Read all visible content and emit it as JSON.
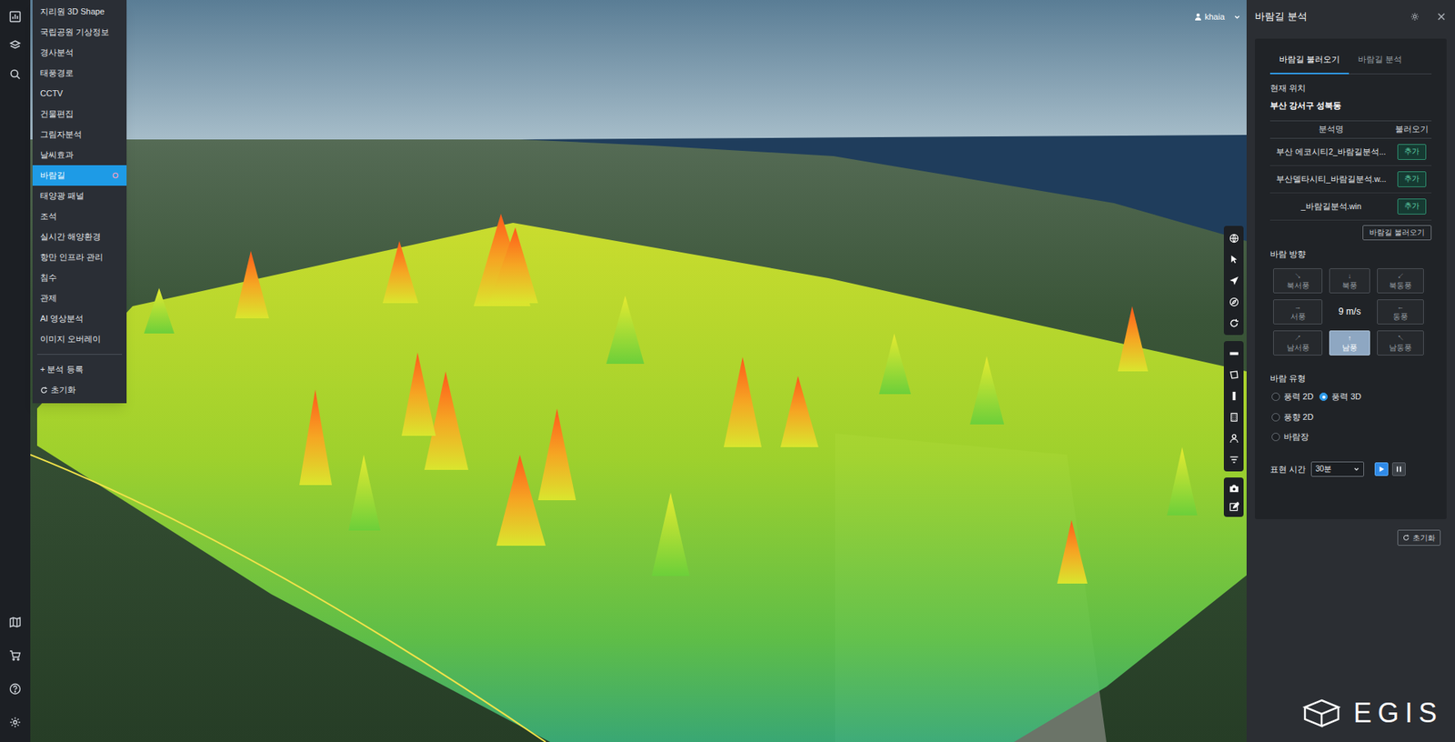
{
  "menu": {
    "items": [
      {
        "label": "지리원 3D Shape",
        "selected": false
      },
      {
        "label": "국립공원 기상정보",
        "selected": false
      },
      {
        "label": "경사분석",
        "selected": false
      },
      {
        "label": "태풍경로",
        "selected": false
      },
      {
        "label": "CCTV",
        "selected": false
      },
      {
        "label": "건물편집",
        "selected": false
      },
      {
        "label": "그림자분석",
        "selected": false
      },
      {
        "label": "날씨효과",
        "selected": false
      },
      {
        "label": "바람길",
        "selected": true
      },
      {
        "label": "태양광 패널",
        "selected": false
      },
      {
        "label": "조석",
        "selected": false
      },
      {
        "label": "실시간 해양환경",
        "selected": false
      },
      {
        "label": "항만 인프라 관리",
        "selected": false
      },
      {
        "label": "침수",
        "selected": false
      },
      {
        "label": "관제",
        "selected": false
      },
      {
        "label": "AI 영상분석",
        "selected": false
      },
      {
        "label": "이미지 오버레이",
        "selected": false
      }
    ],
    "register": "+ 분석 등록",
    "reset": "초기화"
  },
  "user": {
    "name": "khaia"
  },
  "panel": {
    "title": "바람길 분석",
    "tabs": [
      {
        "label": "바람길 불러오기",
        "selected": true
      },
      {
        "label": "바람길 분석",
        "selected": false
      }
    ],
    "location": {
      "label": "현재 위치",
      "value": "부산 강서구 성북동"
    },
    "table": {
      "columns": [
        "분석명",
        "불러오기"
      ],
      "rows": [
        {
          "name": "부산 에코시티2_바람길분석...",
          "action": "추가"
        },
        {
          "name": "부산델타시티_바람길분석.w...",
          "action": "추가"
        },
        {
          "name": "_바람길분석.win",
          "action": "추가"
        }
      ]
    },
    "load_button": "바람길 불러오기",
    "direction": {
      "label": "바람 방향",
      "speed": "9 m/s",
      "buttons": [
        {
          "arrow": "↘",
          "label": "북서풍",
          "selected": false
        },
        {
          "arrow": "↓",
          "label": "북풍",
          "selected": false
        },
        {
          "arrow": "↙",
          "label": "북동풍",
          "selected": false
        },
        {
          "arrow": "→",
          "label": "서풍",
          "selected": false
        },
        {
          "arrow": "←",
          "label": "동풍",
          "selected": false
        },
        {
          "arrow": "↗",
          "label": "남서풍",
          "selected": false
        },
        {
          "arrow": "↑",
          "label": "남풍",
          "selected": true
        },
        {
          "arrow": "↖",
          "label": "남동풍",
          "selected": false
        }
      ]
    },
    "wind_type": {
      "label": "바람 유형",
      "options": [
        {
          "label": "풍력 2D",
          "selected": false
        },
        {
          "label": "풍력 3D",
          "selected": true
        },
        {
          "label": "풍향 2D",
          "selected": false
        },
        {
          "label": "바람장",
          "selected": false
        }
      ]
    },
    "time": {
      "label": "표현 시간",
      "value": "30분",
      "playing": true
    },
    "reset": "초기화"
  },
  "logo": {
    "text": "EGIS"
  }
}
